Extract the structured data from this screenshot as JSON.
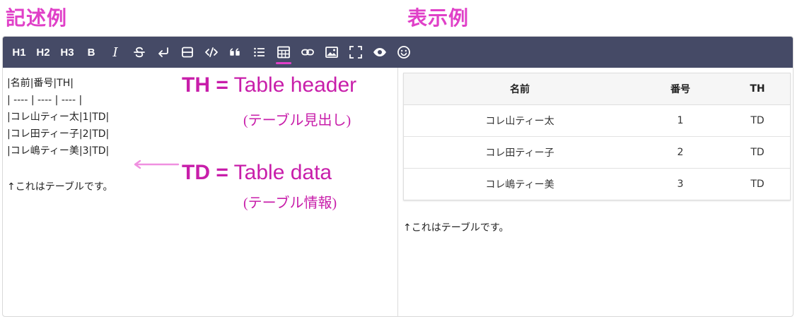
{
  "headings": {
    "left": "記述例",
    "right": "表示例"
  },
  "toolbar": {
    "h1": "H1",
    "h2": "H2",
    "h3": "H3",
    "bold": "B",
    "italic": "I",
    "icons": [
      "strikethrough-icon",
      "line-break-icon",
      "horizontal-rule-icon",
      "code-icon",
      "quote-icon",
      "list-icon",
      "table-icon",
      "link-icon",
      "image-icon",
      "fullscreen-icon",
      "preview-eye-icon",
      "emoji-icon"
    ],
    "active": "table-icon",
    "accent": "#e040c8",
    "bg": "#454a66"
  },
  "markdown": {
    "lines": [
      "|名前|番号|TH|",
      "| ---- | ---- | ---- |",
      "|コレ山ティー太|1|TD|",
      "|コレ田ティー子|2|TD|",
      "|コレ嶋ティー美|3|TD|"
    ],
    "note": "↑これはテーブルです。"
  },
  "annotations": {
    "th": {
      "abbr": "TH =",
      "text": "Table header",
      "sub": "(テーブル見出し)"
    },
    "td": {
      "abbr": "TD =",
      "text": "Table data",
      "sub": "(テーブル情報)"
    },
    "color": "#c81eaa"
  },
  "preview": {
    "headers": [
      "名前",
      "番号",
      "TH"
    ],
    "rows": [
      [
        "コレ山ティー太",
        "1",
        "TD"
      ],
      [
        "コレ田ティー子",
        "2",
        "TD"
      ],
      [
        "コレ嶋ティー美",
        "3",
        "TD"
      ]
    ],
    "note": "↑これはテーブルです。"
  }
}
